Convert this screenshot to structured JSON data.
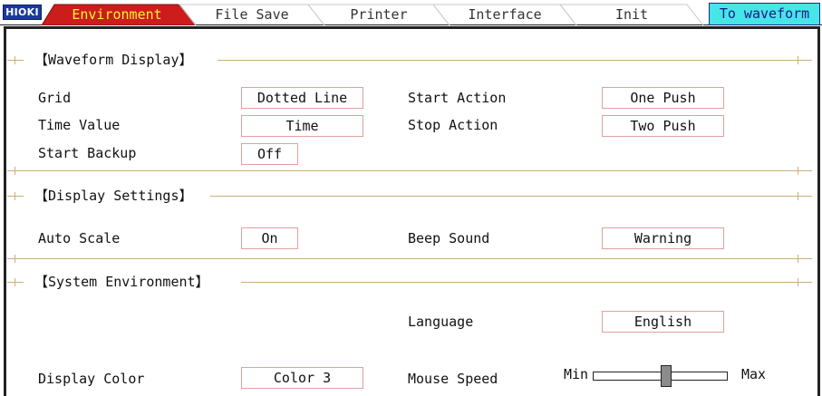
{
  "header": {
    "logo": "HIOKI",
    "tabs": [
      {
        "label": "Environment",
        "active": true
      },
      {
        "label": "File Save",
        "active": false
      },
      {
        "label": "Printer",
        "active": false
      },
      {
        "label": "Interface",
        "active": false
      },
      {
        "label": "Init",
        "active": false
      }
    ],
    "to_waveform": "To waveform"
  },
  "sections": {
    "waveform_display": {
      "title": "【Waveform Display】",
      "grid": {
        "label": "Grid",
        "value": "Dotted Line"
      },
      "time_value": {
        "label": "Time Value",
        "value": "Time"
      },
      "start_backup": {
        "label": "Start Backup",
        "value": "Off"
      },
      "start_action": {
        "label": "Start Action",
        "value": "One Push"
      },
      "stop_action": {
        "label": "Stop Action",
        "value": "Two Push"
      }
    },
    "display_settings": {
      "title": "【Display Settings】",
      "auto_scale": {
        "label": "Auto Scale",
        "value": "On"
      },
      "beep_sound": {
        "label": "Beep Sound",
        "value": "Warning"
      }
    },
    "system_environment": {
      "title": "【System Environment】",
      "language": {
        "label": "Language",
        "value": "English"
      },
      "display_color": {
        "label": "Display Color",
        "value": "Color 3"
      },
      "mouse_speed": {
        "label": "Mouse Speed",
        "min": "Min",
        "max": "Max",
        "level": 0.55
      }
    }
  },
  "colors": {
    "active_tab": "#cc1c1c",
    "active_tab_text": "#f7f730",
    "to_waveform_bg": "#45e6e6",
    "logo_bg": "#1a3a9c",
    "field_border": "#e0a0a0",
    "divider": "#c9b07a"
  }
}
